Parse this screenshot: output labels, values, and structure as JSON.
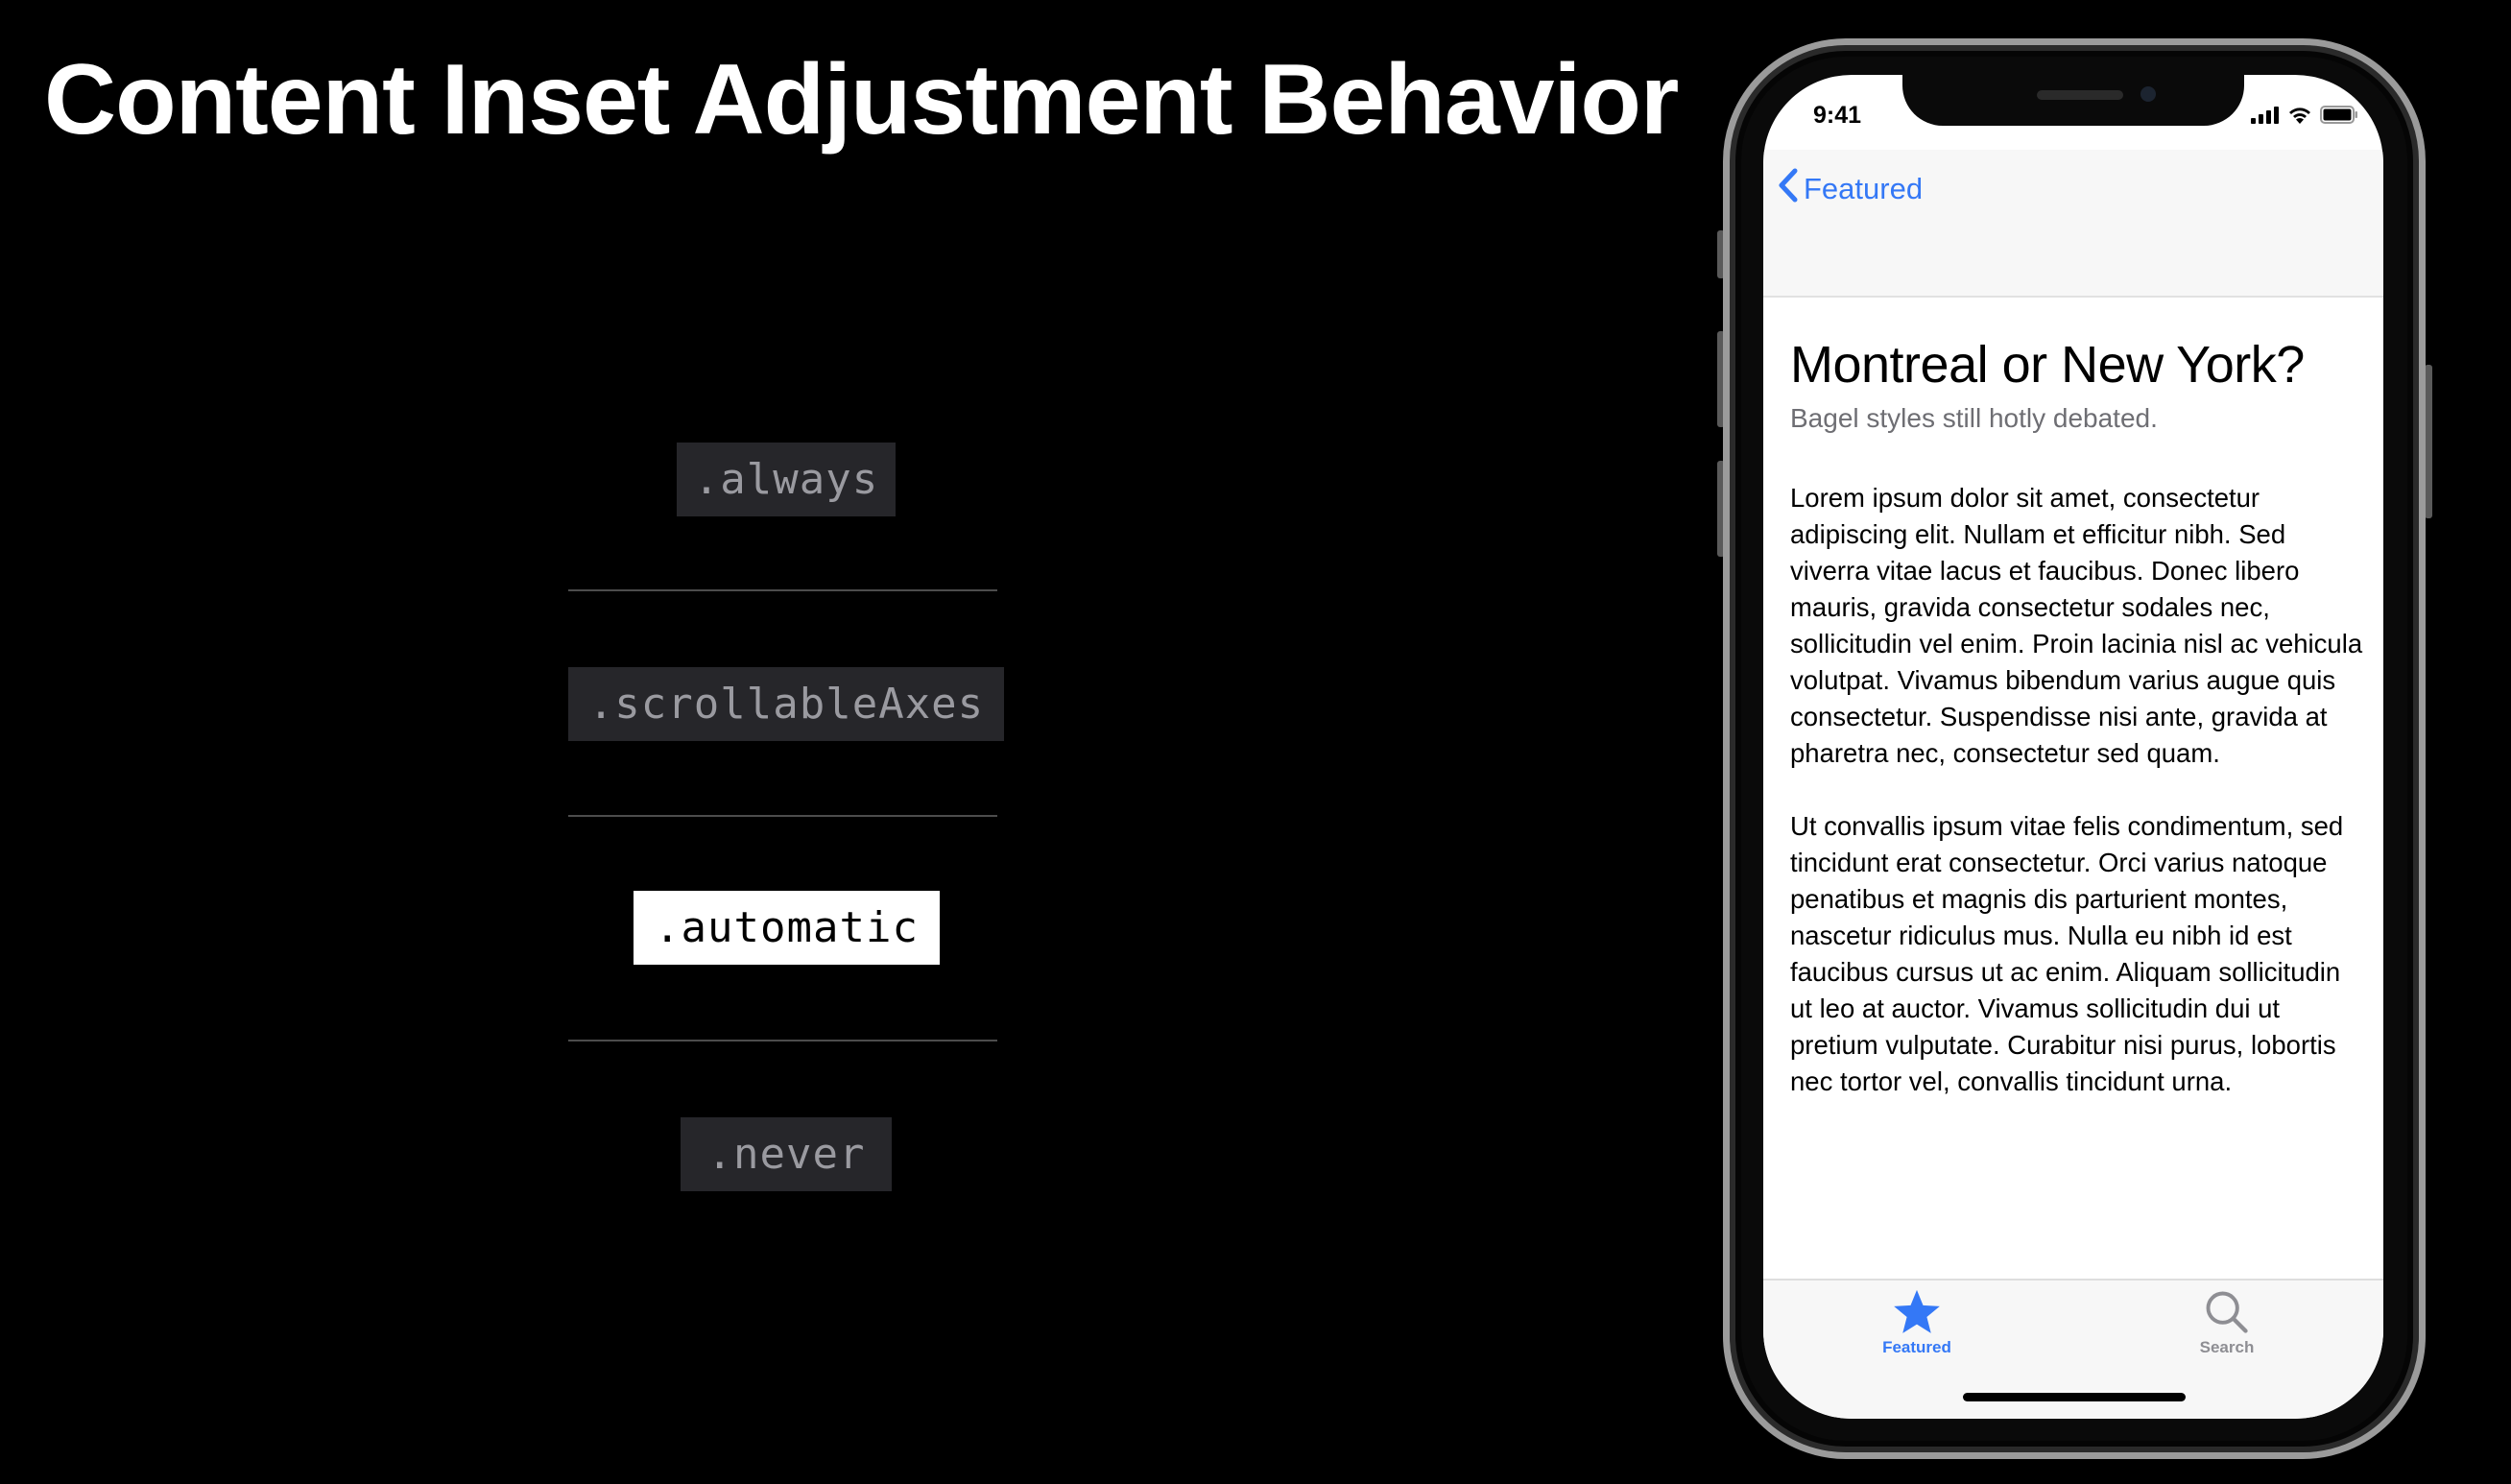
{
  "slide": {
    "title": "Content Inset Adjustment Behavior"
  },
  "options": [
    {
      "label": ".always",
      "selected": false
    },
    {
      "label": ".scrollableAxes",
      "selected": false
    },
    {
      "label": ".automatic",
      "selected": true
    },
    {
      "label": ".never",
      "selected": false
    }
  ],
  "phone": {
    "status_bar": {
      "time": "9:41",
      "icons": [
        "signal-icon",
        "wifi-icon",
        "battery-icon"
      ]
    },
    "nav_bar": {
      "back_label": "Featured",
      "back_icon": "chevron-left-icon"
    },
    "article": {
      "title": "Montreal or New York?",
      "subtitle": "Bagel styles still hotly debated.",
      "paragraphs": [
        "Lorem ipsum dolor sit amet, consectetur adipiscing elit. Nullam et efficitur nibh. Sed viverra vitae lacus et faucibus. Donec libero mauris, gravida consectetur sodales nec, sollicitudin vel enim. Proin lacinia nisl ac vehicula volutpat. Vivamus bibendum varius augue quis consectetur. Suspendisse nisi ante, gravida at pharetra nec, consectetur sed quam.",
        "Ut convallis ipsum vitae felis condimentum, sed tincidunt erat consectetur. Orci varius natoque penatibus et magnis dis parturient montes, nascetur ridiculus mus. Nulla eu nibh id est faucibus cursus ut ac enim. Aliquam sollicitudin ut leo at auctor. Vivamus sollicitudin dui ut pretium vulputate. Curabitur nisi purus, lobortis nec tortor vel, convallis tincidunt urna."
      ]
    },
    "tab_bar": {
      "tabs": [
        {
          "label": "Featured",
          "icon": "star-icon",
          "selected": true
        },
        {
          "label": "Search",
          "icon": "magnifying-glass-icon",
          "selected": false
        }
      ]
    }
  },
  "colors": {
    "background": "#000000",
    "accent": "#3478f6",
    "tab_inactive": "#8e8e93",
    "option_inactive_bg": "#26262a",
    "option_active_bg": "#ffffff"
  }
}
